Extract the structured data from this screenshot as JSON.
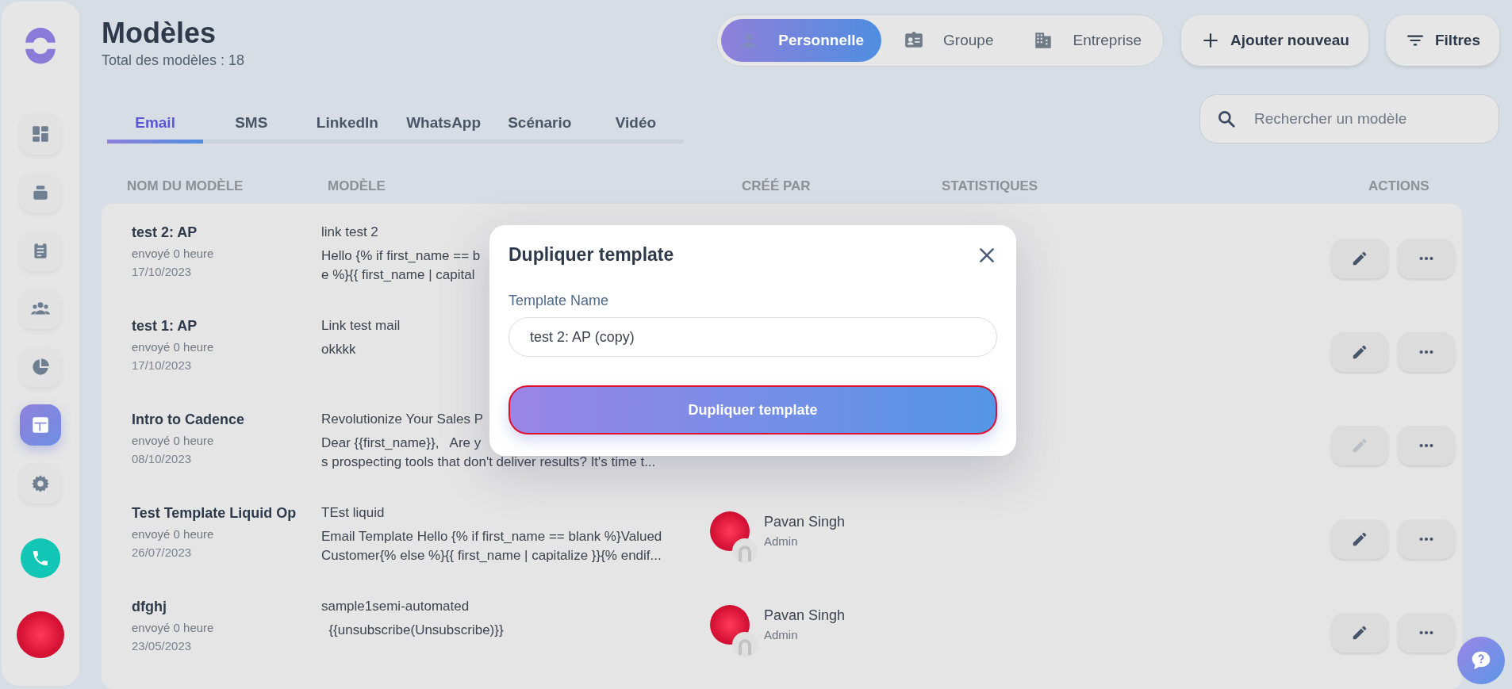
{
  "sidebar": {
    "items": [
      {
        "selected": false
      },
      {
        "selected": false
      },
      {
        "selected": false
      },
      {
        "selected": false
      },
      {
        "selected": false
      },
      {
        "selected": true
      },
      {
        "selected": false
      }
    ]
  },
  "header": {
    "title": "Modèles",
    "subtitle": "Total des modèles : 18"
  },
  "scope_tabs": [
    {
      "label": "Personnelle",
      "selected": true
    },
    {
      "label": "Groupe",
      "selected": false
    },
    {
      "label": "Entreprise",
      "selected": false
    }
  ],
  "add_button": "Ajouter nouveau",
  "filter_button": "Filtres",
  "channel_tabs": [
    {
      "label": "Email",
      "selected": true
    },
    {
      "label": "SMS",
      "selected": false
    },
    {
      "label": "LinkedIn",
      "selected": false
    },
    {
      "label": "WhatsApp",
      "selected": false
    },
    {
      "label": "Scénario",
      "selected": false
    },
    {
      "label": "Vidéo",
      "selected": false
    }
  ],
  "search": {
    "placeholder": "Rechercher un modèle"
  },
  "table": {
    "columns": [
      "NOM DU MODÈLE",
      "MODÈLE",
      "CRÉÉ PAR",
      "STATISTIQUES",
      "ACTIONS"
    ],
    "rows": [
      {
        "name": "test 2: AP",
        "sent": "envoyé 0 heure",
        "date": "17/10/2023",
        "subject": "link test 2",
        "preview": [
          "Hello {% if first_name == b",
          "e %}{{ first_name | capital"
        ],
        "edit_disabled": false
      },
      {
        "name": "test 1: AP",
        "sent": "envoyé 0 heure",
        "date": "17/10/2023",
        "subject": "Link test mail",
        "preview": [
          "okkkk"
        ],
        "edit_disabled": false
      },
      {
        "name": "Intro to Cadence",
        "sent": "envoyé 0 heure",
        "date": "08/10/2023",
        "subject": "Revolutionize Your Sales P",
        "preview": [
          "Dear {{first_name}},   Are y",
          "s prospecting tools that don't deliver results? It's time t..."
        ],
        "edit_disabled": true
      },
      {
        "name": "Test Template Liquid Op",
        "sent": "envoyé 0 heure",
        "date": "26/07/2023",
        "subject": "TEst liquid",
        "preview": [
          "Email Template Hello {% if first_name == blank %}Valued",
          "Customer{% else %}{{ first_name | capitalize }}{% endif..."
        ],
        "creator": {
          "name": "Pavan Singh",
          "role": "Admin"
        },
        "edit_disabled": false
      },
      {
        "name": "dfghj",
        "sent": "envoyé 0 heure",
        "date": "23/05/2023",
        "subject": "sample1semi-automated",
        "preview": [
          "  {{unsubscribe(Unsubscribe)}}"
        ],
        "creator": {
          "name": "Pavan Singh",
          "role": "Admin"
        },
        "edit_disabled": false
      }
    ]
  },
  "modal": {
    "title": "Dupliquer template",
    "field_label": "Template Name",
    "field_value": "test 2: AP (copy)",
    "submit": "Dupliquer template"
  }
}
